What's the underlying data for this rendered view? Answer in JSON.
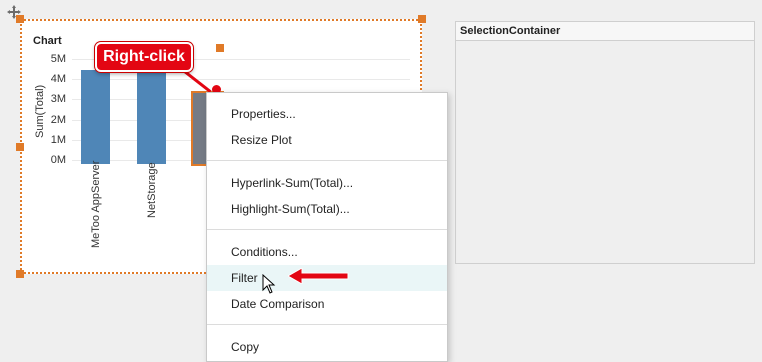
{
  "chart": {
    "title": "Chart",
    "ylabel": "Sum(Total)",
    "yticks": [
      "5M",
      "4M",
      "3M",
      "2M",
      "1M",
      "0M"
    ]
  },
  "chart_data": {
    "type": "bar",
    "categories": [
      "MeToo AppServer",
      "NetStorage",
      ""
    ],
    "values": [
      4500000,
      4500000,
      3400000
    ],
    "title": "Chart",
    "xlabel": "",
    "ylabel": "Sum(Total)",
    "ylim": [
      0,
      5000000
    ],
    "grid": true
  },
  "annotation": {
    "callout_text": "Right-click",
    "callout_color": "#e30613"
  },
  "selection_panel": {
    "title": "SelectionContainer"
  },
  "context_menu": {
    "items": [
      "Properties...",
      "Resize Plot",
      "Hyperlink-Sum(Total)...",
      "Highlight-Sum(Total)...",
      "Conditions...",
      "Filter",
      "Date Comparison",
      "Copy"
    ],
    "hovered": "Filter"
  },
  "colors": {
    "bar": "#4f86b7",
    "selected_bar": "#757b85",
    "selection_border": "#e07a28",
    "menu_hover": "#eaf6f7"
  }
}
